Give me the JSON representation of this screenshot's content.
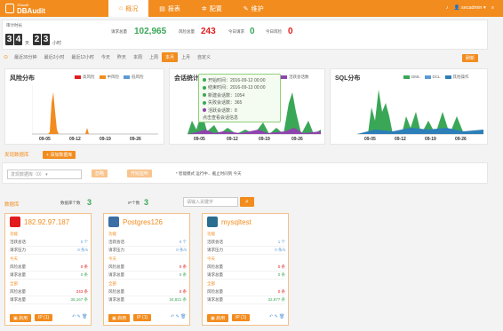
{
  "header": {
    "logo_small": "JSaudit",
    "logo_big": "DBAudit",
    "tabs": [
      {
        "label": "概况",
        "icon": "home-icon"
      },
      {
        "label": "报表",
        "icon": "report-icon"
      },
      {
        "label": "配置",
        "icon": "gear-icon"
      },
      {
        "label": "维护",
        "icon": "wrench-icon"
      }
    ],
    "user": "secadmin",
    "bell_icon": "bell-icon",
    "menu_icon": "menu-icon"
  },
  "uptime": {
    "label": "审计时长",
    "days": [
      "3",
      "4"
    ],
    "day_unit": "天",
    "hours": [
      "2",
      "3"
    ],
    "hour_unit": "小时"
  },
  "stats": [
    {
      "label": "请求总量",
      "value": "102,965",
      "color": "#3aa757"
    },
    {
      "label": "风险总量",
      "value": "243",
      "color": "#e21c1c"
    },
    {
      "label": "今日请求",
      "value": "0",
      "color": "#3aa757"
    },
    {
      "label": "今日风险",
      "value": "0",
      "color": "#e21c1c"
    }
  ],
  "filters": {
    "items": [
      "最近30分钟",
      "最近2小时",
      "最近12小时",
      "今天",
      "昨天",
      "本周",
      "上周",
      "本月",
      "上月",
      "自定义"
    ],
    "active": "本月",
    "refresh_label": "刷新"
  },
  "charts": {
    "risk": {
      "title": "风险分布",
      "legend": [
        {
          "name": "高风险",
          "color": "#e21c1c"
        },
        {
          "name": "中风险",
          "color": "#f28c1e"
        },
        {
          "name": "低风险",
          "color": "#5b9bd5"
        }
      ],
      "ticks": [
        "09-05",
        "09-12",
        "09-19",
        "09-26"
      ]
    },
    "session": {
      "title": "会话统计",
      "legend": [
        {
          "name": "活跃会话数",
          "color": "#8e44ad"
        }
      ],
      "ticks": [
        "09-05",
        "09-12",
        "09-19",
        "09-26"
      ]
    },
    "sql": {
      "title": "SQL分布",
      "legend": [
        {
          "name": "DML",
          "color": "#3aa757"
        },
        {
          "name": "DCL",
          "color": "#5b9bd5"
        },
        {
          "name": "其他操作",
          "color": "#2c7fb8"
        }
      ],
      "ticks": [
        "09-05",
        "09-12",
        "09-19",
        "09-26"
      ]
    }
  },
  "tooltip": {
    "lines": [
      {
        "text": "开始时间：2016-09-12 00:00",
        "color": "#3aa757"
      },
      {
        "text": "结束时间：2016-09-13 00:00",
        "color": "#3aa757"
      },
      {
        "text": "新建会话数：1054",
        "color": "#3aa757"
      },
      {
        "text": "失败会话数：365",
        "color": "#3aa757"
      },
      {
        "text": "活跃会话数：8",
        "color": "#8e44ad"
      },
      {
        "text": "点击查看会话信息",
        "color": "#3aa757"
      }
    ]
  },
  "discovered": {
    "title": "发现数据库",
    "add_button": "添加数据库",
    "select_placeholder": "发现数据库（0）",
    "ignore_button": "忽略",
    "start_button": "开始监听",
    "note": "* 智能模式 运行中... 截止时间到 今天"
  },
  "db_section": {
    "title": "数据库",
    "total_label": "数据库个数",
    "total_value": "3",
    "ip_label": "IP个数",
    "ip_value": "3",
    "search_placeholder": "请输入关键字",
    "search_icon": "search-icon"
  },
  "databases": [
    {
      "name": "182.92.97.187",
      "icon_color": "#e21c1c",
      "sections": [
        "功能",
        "今天",
        "全部"
      ],
      "rows": [
        {
          "k": "活跃会话",
          "v": "0 个"
        },
        {
          "k": "请求压力",
          "v": "0 条/s"
        },
        {
          "k": "风险总量",
          "v": "0 条"
        },
        {
          "k": "请求总量",
          "v": "0 条"
        },
        {
          "k": "风险总量",
          "v": "243 条"
        },
        {
          "k": "请求总量",
          "v": "35,167 条"
        }
      ],
      "buttons": [
        "启用",
        "IP (1)"
      ]
    },
    {
      "name": "Postgres126",
      "icon_color": "#3b6ea5",
      "sections": [
        "功能",
        "今天",
        "全部"
      ],
      "rows": [
        {
          "k": "活跃会话",
          "v": "0 个"
        },
        {
          "k": "请求压力",
          "v": "0 条/s"
        },
        {
          "k": "风险总量",
          "v": "0 条"
        },
        {
          "k": "请求总量",
          "v": "0 条"
        },
        {
          "k": "风险总量",
          "v": "0 条"
        },
        {
          "k": "请求总量",
          "v": "34,821 条"
        }
      ],
      "buttons": [
        "启用",
        "IP (1)"
      ]
    },
    {
      "name": "mysqltest",
      "icon_color": "#2a6d8f",
      "sections": [
        "功能",
        "今天",
        "全部"
      ],
      "rows": [
        {
          "k": "活跃会话",
          "v": "1 个"
        },
        {
          "k": "请求压力",
          "v": "0 条/s"
        },
        {
          "k": "风险总量",
          "v": "0 条"
        },
        {
          "k": "请求总量",
          "v": "0 条"
        },
        {
          "k": "风险总量",
          "v": "0 条"
        },
        {
          "k": "请求总量",
          "v": "32,877 条"
        }
      ],
      "buttons": [
        "启用",
        "IP (1)"
      ]
    }
  ]
}
